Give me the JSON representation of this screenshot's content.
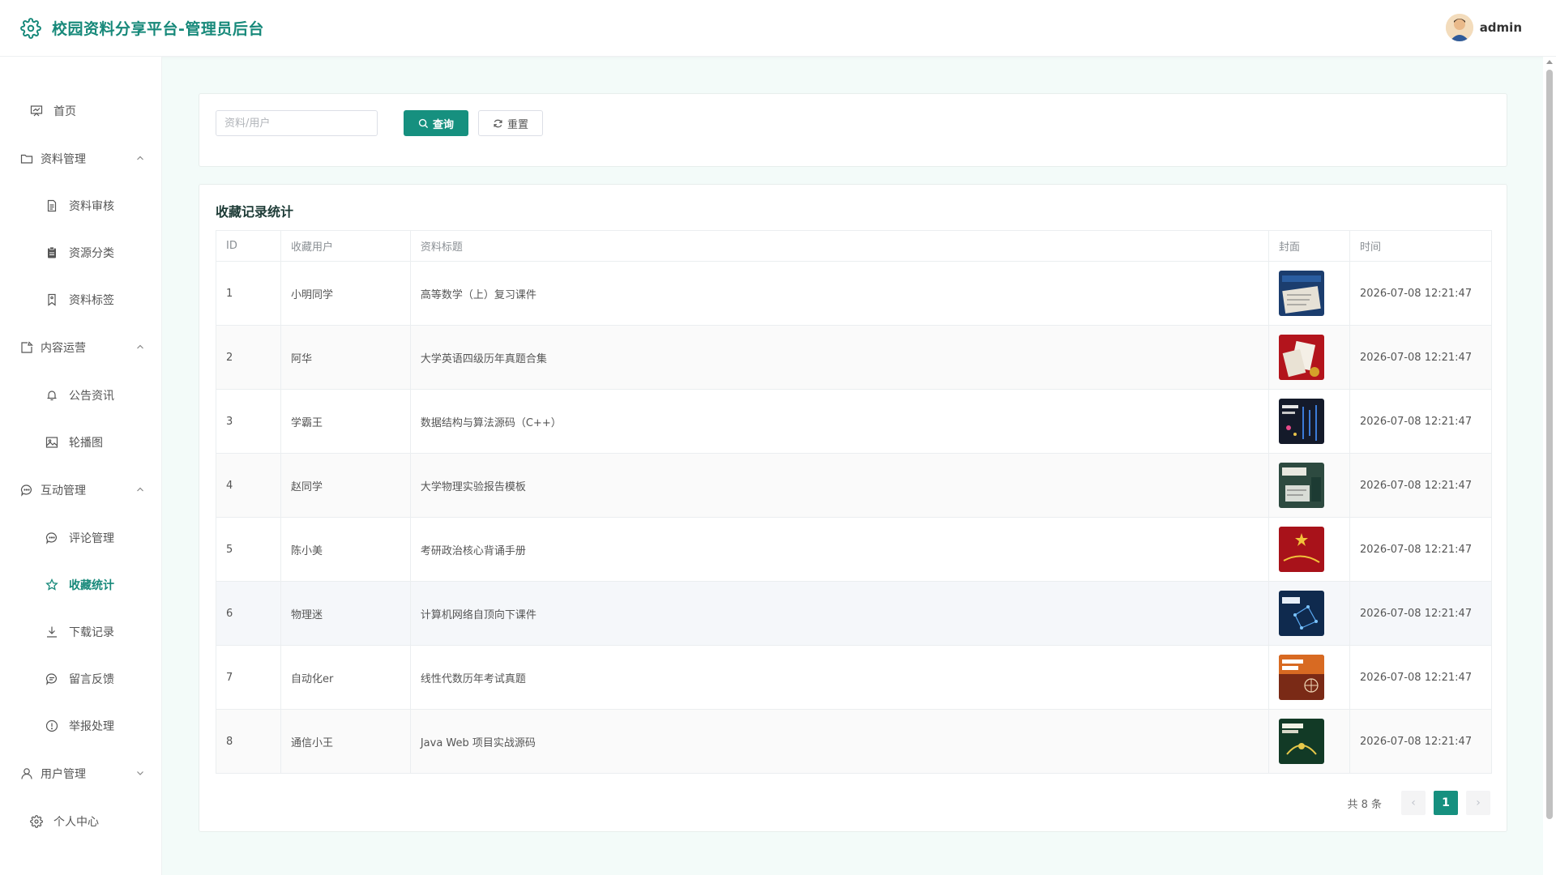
{
  "header": {
    "title": "校园资料分享平台-管理员后台",
    "user_name": "admin"
  },
  "sidebar": {
    "home": "首页",
    "groups": [
      {
        "label": "资料管理",
        "items": [
          "资料审核",
          "资源分类",
          "资料标签"
        ]
      },
      {
        "label": "内容运营",
        "items": [
          "公告资讯",
          "轮播图"
        ]
      },
      {
        "label": "互动管理",
        "items": [
          "评论管理",
          "收藏统计",
          "下载记录",
          "留言反馈",
          "举报处理"
        ]
      },
      {
        "label": "用户管理",
        "items": []
      }
    ],
    "profile": "个人中心",
    "active": "收藏统计"
  },
  "search": {
    "placeholder": "资料/用户",
    "query_label": "查询",
    "reset_label": "重置"
  },
  "table": {
    "title": "收藏记录统计",
    "columns": [
      "ID",
      "收藏用户",
      "资料标题",
      "封面",
      "时间"
    ],
    "rows": [
      {
        "id": "1",
        "user": "小明同学",
        "title": "高等数学（上）复习课件",
        "time": "2026-07-08 12:21:47"
      },
      {
        "id": "2",
        "user": "阿华",
        "title": "大学英语四级历年真题合集",
        "time": "2026-07-08 12:21:47"
      },
      {
        "id": "3",
        "user": "学霸王",
        "title": "数据结构与算法源码（C++）",
        "time": "2026-07-08 12:21:47"
      },
      {
        "id": "4",
        "user": "赵同学",
        "title": "大学物理实验报告模板",
        "time": "2026-07-08 12:21:47"
      },
      {
        "id": "5",
        "user": "陈小美",
        "title": "考研政治核心背诵手册",
        "time": "2026-07-08 12:21:47"
      },
      {
        "id": "6",
        "user": "物理迷",
        "title": "计算机网络自顶向下课件",
        "time": "2026-07-08 12:21:47"
      },
      {
        "id": "7",
        "user": "自动化er",
        "title": "线性代数历年考试真题",
        "time": "2026-07-08 12:21:47"
      },
      {
        "id": "8",
        "user": "通信小王",
        "title": "Java Web 项目实战源码",
        "time": "2026-07-08 12:21:47"
      }
    ]
  },
  "pagination": {
    "total": "共 8 条",
    "current": "1",
    "prev": "‹",
    "next": "›"
  },
  "colors": {
    "accent": "#16907f",
    "title": "#17897a",
    "background": "#f3fbf9"
  }
}
